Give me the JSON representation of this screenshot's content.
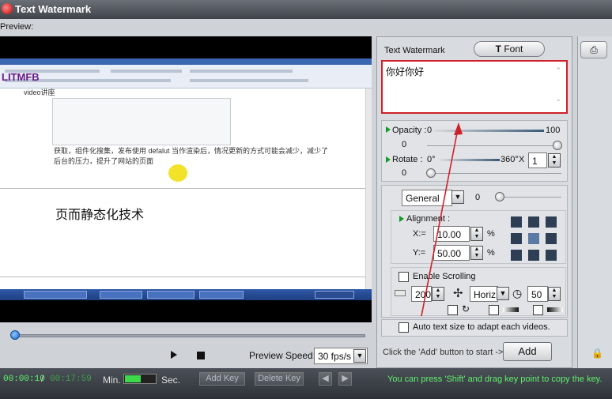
{
  "window": {
    "title": "Text Watermark"
  },
  "preview": {
    "label": "Preview:",
    "watermark_logo": "LITMFB",
    "watermark_sub": "video讲座",
    "doc_line1": "获取，组件化搜集，发布使用 defalut 当作渲染后，情况更新的方式可能会减少，减少了",
    "doc_line2": "后台的压力，提升了网站的页面",
    "doc_text": "页而静态化技术"
  },
  "playback": {
    "speed_label": "Preview Speed:",
    "speed_value": "30 fps/s"
  },
  "bottom": {
    "time_current": "00:00:10",
    "time_sep": "/",
    "time_total": "00:17:59",
    "min_label": "Min.",
    "sec_label": "Sec.",
    "add_key": "Add Key",
    "delete_key": "Delete Key",
    "hint": "You can press 'Shift' and drag key point to copy the key."
  },
  "panel": {
    "tab_watermark": "Text Watermark",
    "tab_font": "Font",
    "tab_font_icon": "T",
    "text_value": "你好你好",
    "opacity_label": "Opacity :",
    "opacity_min": "0",
    "opacity_max": "100",
    "opacity_value": "0",
    "rotate_label": "Rotate :",
    "rotate_min": "0°",
    "rotate_max": "360°",
    "rotate_x": "X",
    "rotate_mult": "1",
    "rotate_value": "0",
    "mode_select": "General",
    "mode_value": "0",
    "alignment_label": "Alignment :",
    "x_label": "X:=",
    "x_value": "10.00",
    "y_label": "Y:=",
    "y_value": "50.00",
    "pct": "%",
    "enable_scrolling": "Enable Scrolling",
    "scroll_speed": "200",
    "scroll_dir": "Horiz",
    "scroll_time": "50",
    "auto_text_size": "Auto text size to adapt each videos.",
    "add_hint": "Click the 'Add' button to start ->",
    "add_button": "Add"
  },
  "colors": {
    "accent_green": "#5ff06a",
    "highlight_red": "#d0202a",
    "title_bar": "#4b5058"
  }
}
